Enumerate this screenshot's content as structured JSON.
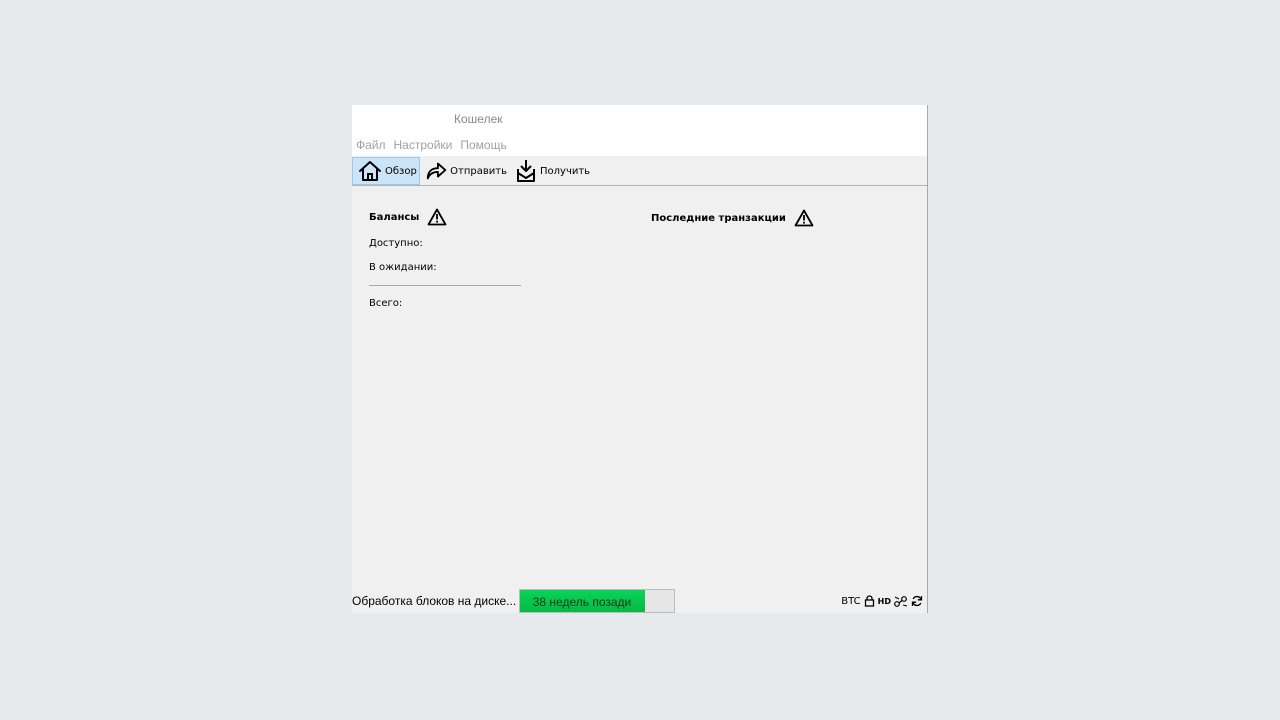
{
  "window": {
    "title": "Кошелек"
  },
  "menu": {
    "items": [
      "Файл",
      "Настройки",
      "Помощь"
    ]
  },
  "toolbar": {
    "overview_label": "Обзор",
    "send_label": "Отправить",
    "receive_label": "Получить"
  },
  "balances": {
    "title": "Балансы",
    "available_label": "Доступно:",
    "pending_label": "В ожидании:",
    "total_label": "Всего:"
  },
  "transactions": {
    "title": "Последние транзакции"
  },
  "statusbar": {
    "progress_label": "Обработка блоков на диске...",
    "progress_text": "38 недель позади",
    "progress_fraction": 0.81,
    "unit": "BTC",
    "hd_badge": "HD",
    "accent_color": "#0ad35b"
  }
}
